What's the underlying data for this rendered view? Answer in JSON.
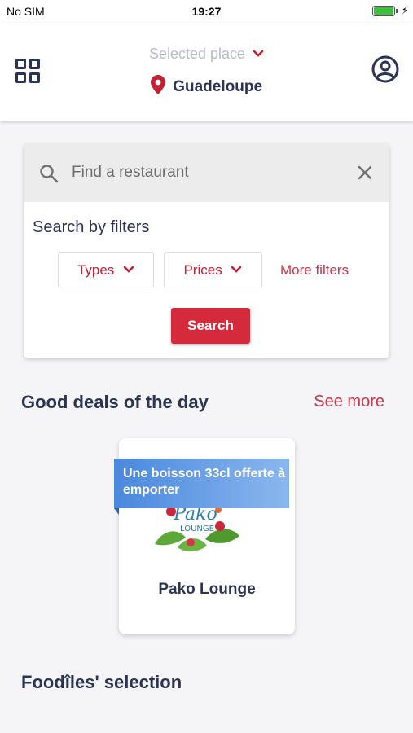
{
  "status_bar": {
    "carrier": "No SIM",
    "time": "19:27",
    "battery_color": "#3dc13c"
  },
  "header": {
    "grid_icon": "grid-icon",
    "profile_icon": "user-circle-icon",
    "place_label": "Selected place",
    "place_name": "Guadeloupe",
    "accent_color": "#c51f34"
  },
  "search": {
    "placeholder": "Find a restaurant",
    "filters_title": "Search by filters",
    "types_label": "Types",
    "prices_label": "Prices",
    "more_filters_label": "More filters",
    "search_button_label": "Search"
  },
  "good_deals": {
    "title": "Good deals of the day",
    "see_more_label": "See more",
    "items": [
      {
        "offer": "Une boisson 33cl offerte à emporter",
        "restaurant": "Pako Lounge",
        "logo_text": "Pako",
        "logo_subtext": "LOUNGE"
      }
    ]
  },
  "selection": {
    "title": "Foodîles' selection"
  }
}
